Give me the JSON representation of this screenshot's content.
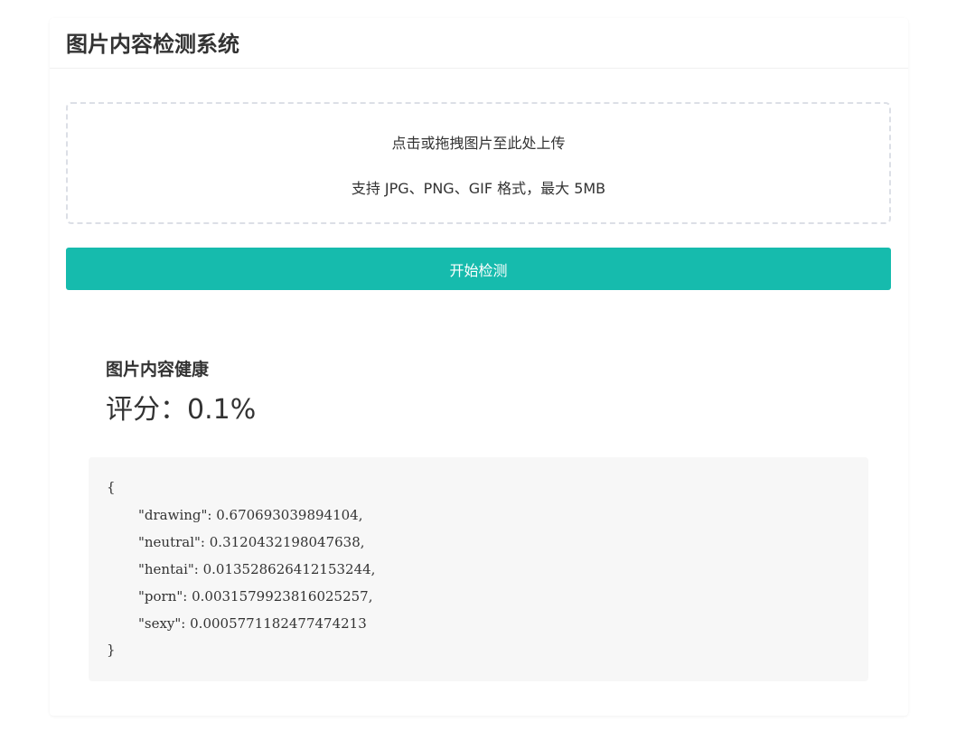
{
  "header": {
    "title": "图片内容检测系统"
  },
  "upload": {
    "hint": "点击或拖拽图片至此处上传",
    "formats": "支持 JPG、PNG、GIF 格式，最大 5MB"
  },
  "actions": {
    "start_label": "开始检测"
  },
  "result": {
    "status": "图片内容健康",
    "score": "评分：0.1%",
    "json_lines": [
      "{",
      "\"drawing\": 0.670693039894104,",
      "\"neutral\": 0.3120432198047638,",
      "\"hentai\": 0.013528626412153244,",
      "\"porn\": 0.0031579923816025257,",
      "\"sexy\": 0.0005771182477474213",
      "}"
    ]
  },
  "colors": {
    "accent": "#16bbad",
    "code_background": "#f7f7f7",
    "upload_border": "#dcdfe6"
  }
}
